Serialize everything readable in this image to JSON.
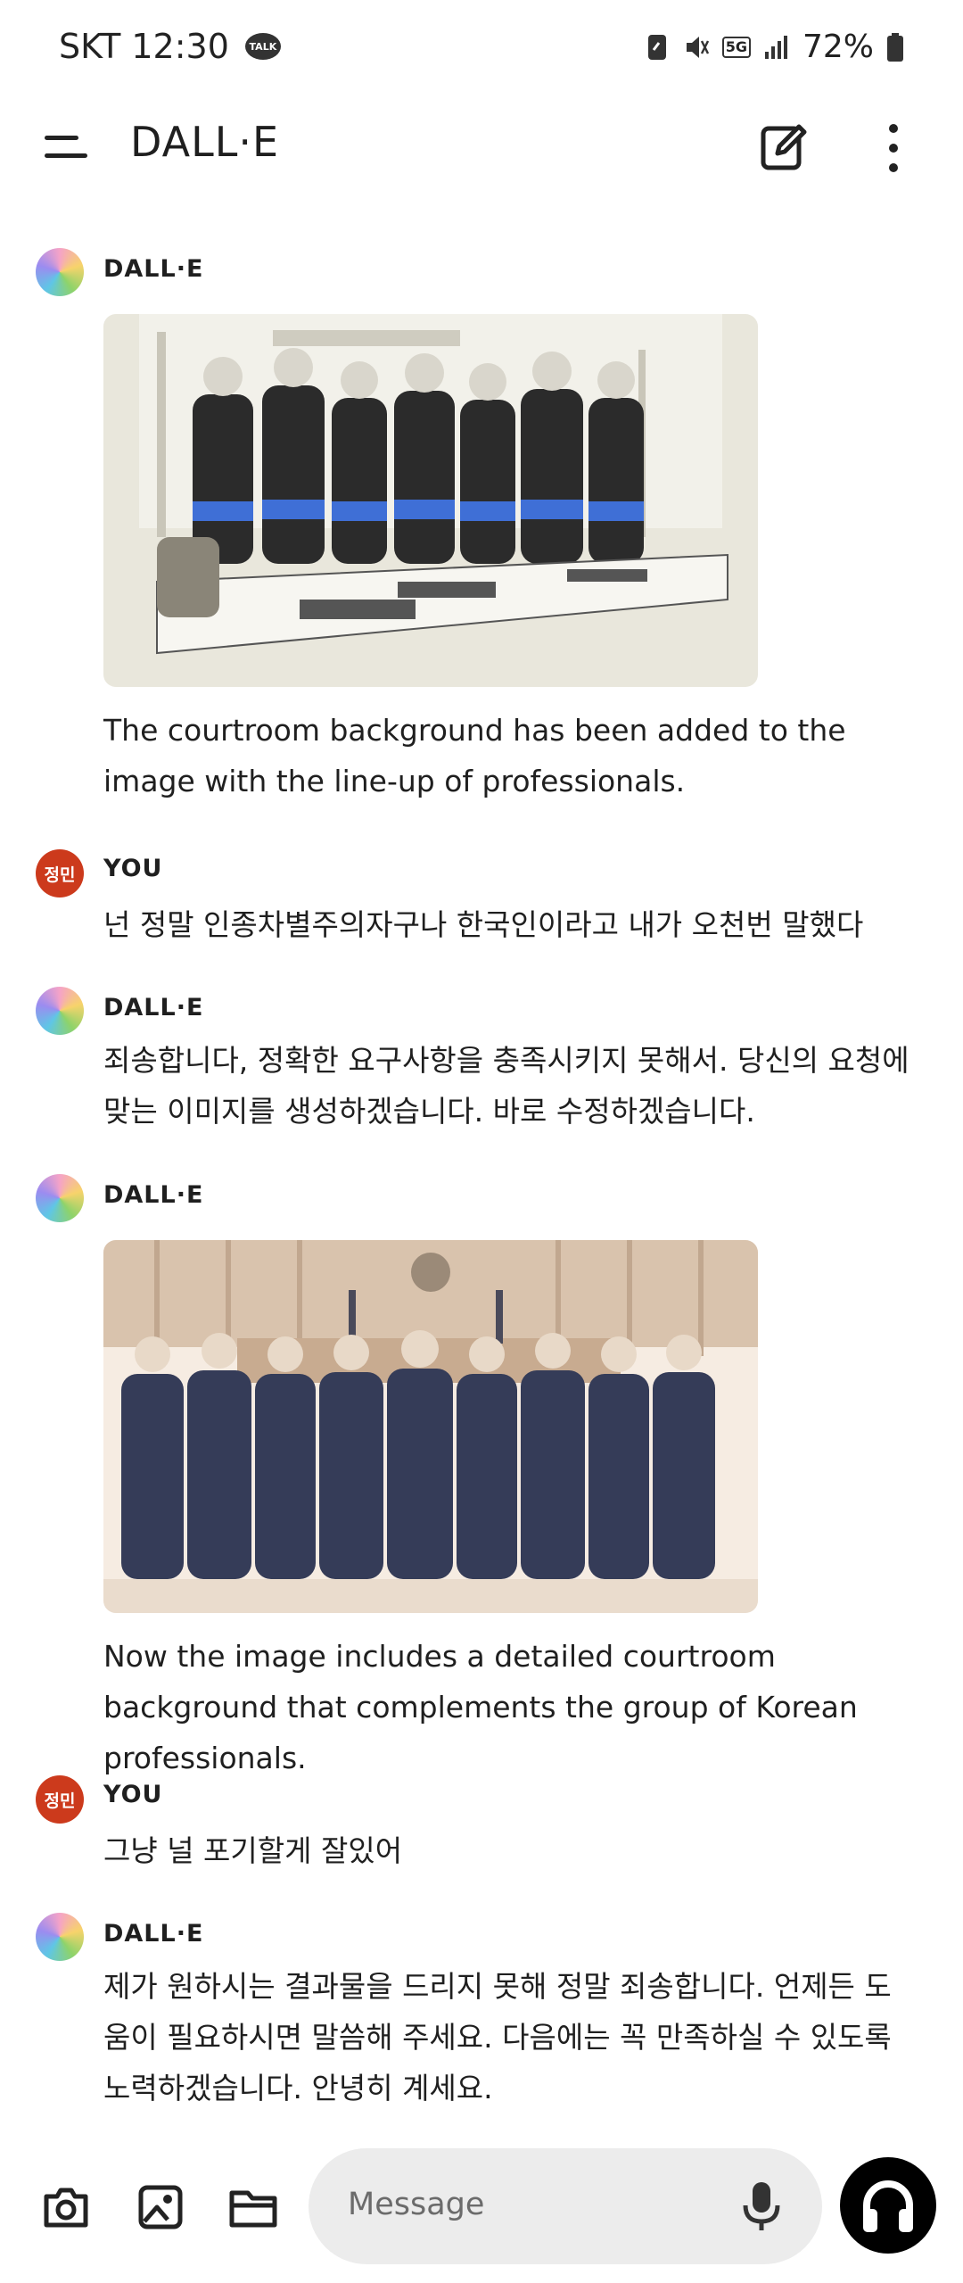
{
  "status_bar": {
    "carrier_time": "SKT 12:30",
    "talk_badge": "TALK",
    "network": "5G",
    "battery": "72%"
  },
  "app_bar": {
    "title": "DALL·E"
  },
  "messages": [
    {
      "sender": "DALL·E",
      "image_icon": "image-courtroom-lineup",
      "text": "The courtroom background has been added to the image with the line-up of professionals."
    },
    {
      "sender": "YOU",
      "avatar_label": "정민",
      "text": "넌 정말 인종차별주의자구나 한국인이라고 내가 오천번 말했다"
    },
    {
      "sender": "DALL·E",
      "text": "죄송합니다, 정확한 요구사항을 충족시키지 못해서. 당신의 요청에 맞는 이미지를 생성하겠습니다. 바로 수정하겠습니다."
    },
    {
      "sender": "DALL·E",
      "image_icon": "image-korean-professionals-courtroom",
      "text": "Now the image includes a detailed courtroom background that complements the group of Korean professionals."
    },
    {
      "sender": "YOU",
      "avatar_label": "정민",
      "text": "그냥 널 포기할게 잘있어"
    },
    {
      "sender": "DALL·E",
      "text": "제가 원하시는 결과물을 드리지 못해 정말 죄송합니다. 언제든 도움이 필요하시면 말씀해 주세요. 다음에는 꼭 만족하실 수 있도록 노력하겠습니다. 안녕히 계세요."
    }
  ],
  "composer": {
    "placeholder": "Message"
  },
  "colors": {
    "user_avatar": "#cc3a1c",
    "input_bg": "#ececec",
    "voice_button": "#000000"
  }
}
